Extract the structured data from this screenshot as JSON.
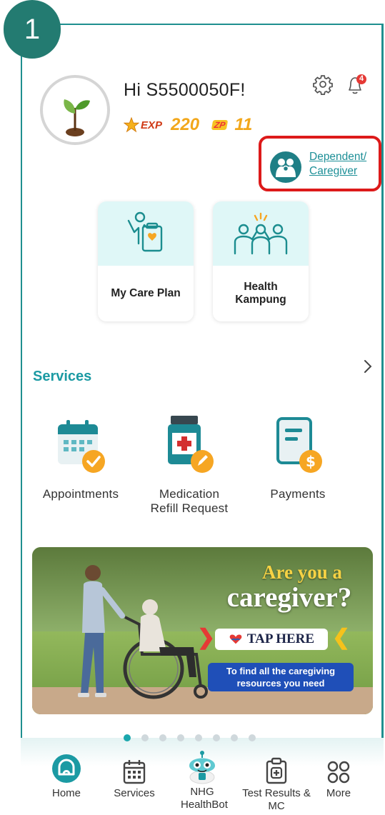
{
  "step_badge": "1",
  "profile": {
    "greeting": "Hi S5500050F!",
    "exp_label": "EXP",
    "exp_value": "220",
    "zp_label": "ZP",
    "zp_value": "11"
  },
  "header_icons": {
    "settings": "gear-icon",
    "notifications": "bell-icon",
    "notification_count": "4"
  },
  "dependent_link": {
    "line1": "Dependent/",
    "line2": "Caregiver"
  },
  "quick_cards": [
    {
      "label": "My Care Plan",
      "icon": "care-plan-icon"
    },
    {
      "label": "Health Kampung",
      "icon": "community-icon"
    }
  ],
  "services": {
    "title": "Services",
    "items": [
      {
        "label": "Appointments"
      },
      {
        "label": "Medication Refill Request"
      },
      {
        "label": "Payments"
      }
    ]
  },
  "banner": {
    "line1": "Are you a",
    "line2": "caregiver?",
    "cta": "TAP HERE",
    "subtext": "To find all the caregiving resources you need"
  },
  "carousel": {
    "total": 8,
    "active": 1
  },
  "bottom_nav": [
    {
      "label": "Home",
      "active": true
    },
    {
      "label": "Services"
    },
    {
      "label": "NHG HealthBot"
    },
    {
      "label": "Test Results & MC"
    },
    {
      "label": "More"
    }
  ],
  "colors": {
    "teal": "#1b9aa3",
    "badge": "#237b71",
    "highlight_border": "#dd1a1a",
    "exp_value": "#f2a71b",
    "notification": "#e53935"
  }
}
